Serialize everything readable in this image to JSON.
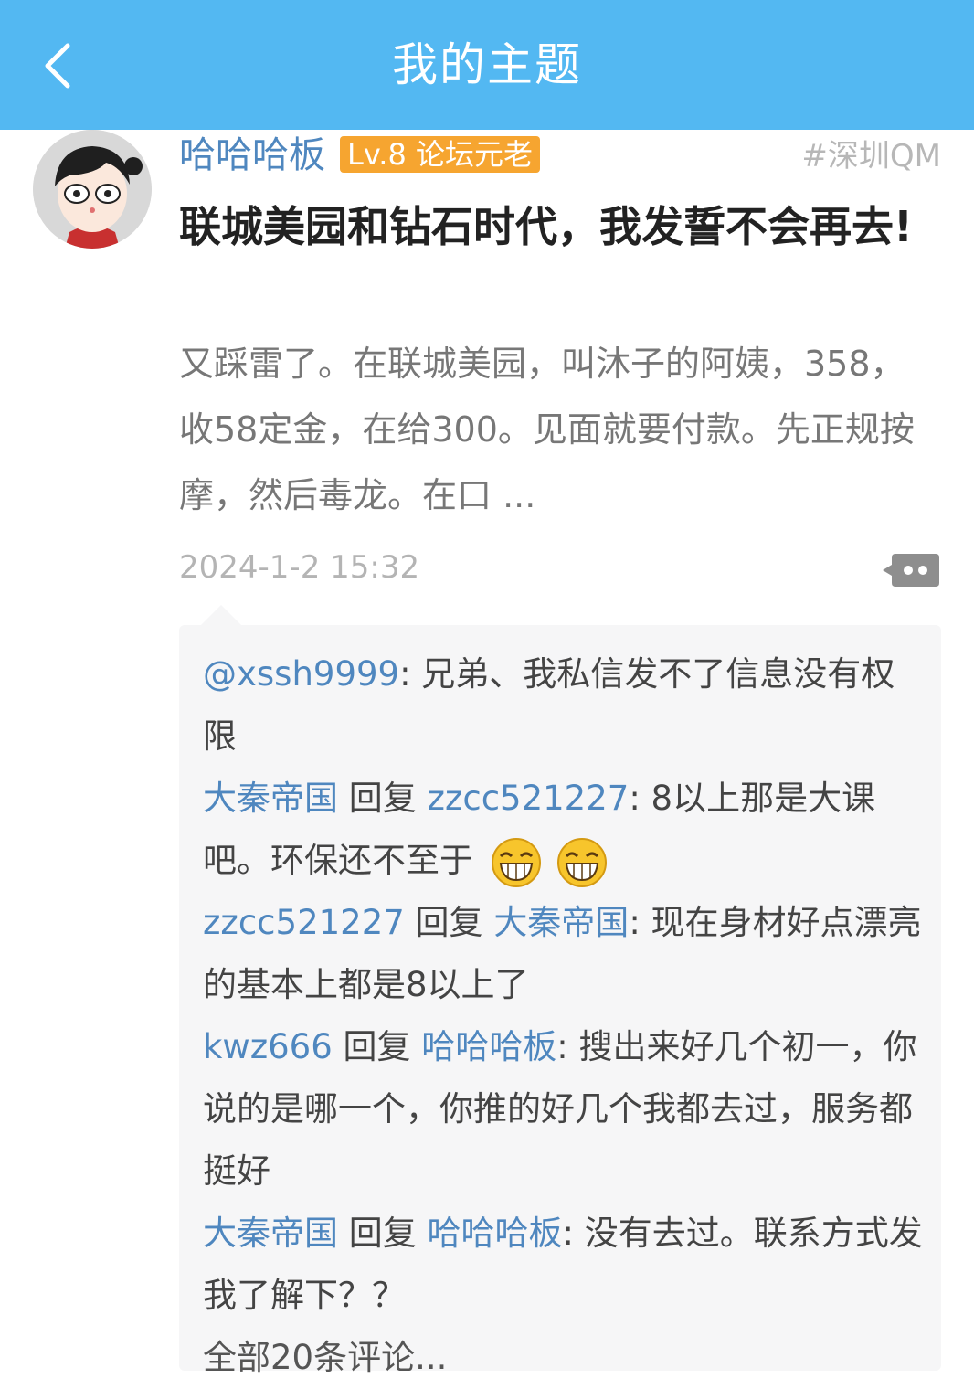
{
  "header": {
    "title": "我的主题"
  },
  "post": {
    "author": "哈哈哈板",
    "level_badge": "Lv.8 论坛元老",
    "location_tag": "#深圳QM",
    "title": "联城美园和钻石时代，我发誓不会再去!",
    "body": "又踩雷了。在联城美园，叫沐子的阿姨，358，收58定金，在给300。见面就要付款。先正规按摩，然后毒龙。在口 ...",
    "date": "2024-1-2 15:32"
  },
  "comments": [
    {
      "user": "@xssh9999",
      "text": ": 兄弟、我私信发不了信息没有权限"
    },
    {
      "user": "大秦帝国",
      "reply_word": " 回复 ",
      "reply_to": "zzcc521227",
      "text": ": 8以上那是大课吧。环保还不至于",
      "emoji": [
        "grin-emoji",
        "grin-emoji"
      ]
    },
    {
      "user": "zzcc521227",
      "reply_word": " 回复 ",
      "reply_to": "大秦帝国",
      "text": ": 现在身材好点漂亮的基本上都是8以上了"
    },
    {
      "user": "kwz666",
      "reply_word": " 回复 ",
      "reply_to": "哈哈哈板",
      "text": ": 搜出来好几个初一，你说的是哪一个，你推的好几个我都去过，服务都挺好"
    },
    {
      "user": "大秦帝国",
      "reply_word": " 回复 ",
      "reply_to": "哈哈哈板",
      "text": ": 没有去过。联系方式发我了解下？？"
    }
  ],
  "all_comments_label": "全部20条评论...",
  "colors": {
    "header": "#53b8f2",
    "username": "#4f87bf",
    "badge": "#f6a530"
  }
}
